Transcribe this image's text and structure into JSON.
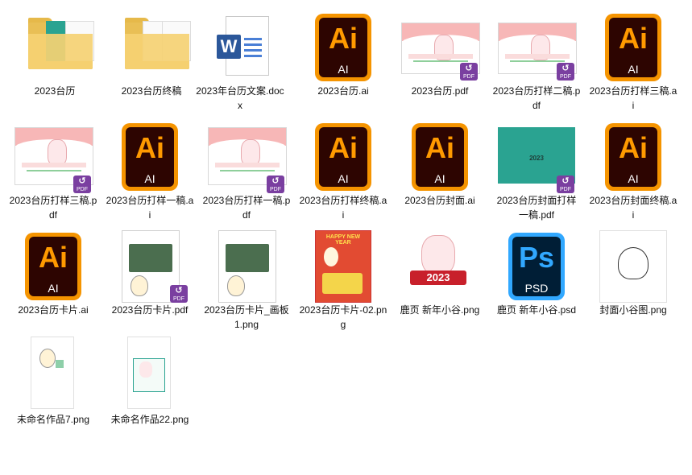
{
  "files": [
    {
      "name": "2023台历",
      "icon": "folder-icon",
      "type": "folder"
    },
    {
      "name": "2023台历终稿",
      "icon": "folder-icon",
      "type": "folder"
    },
    {
      "name": "2023年台历文案.docx",
      "icon": "word-doc-icon",
      "type": "docx"
    },
    {
      "name": "2023台历.ai",
      "icon": "illustrator-icon",
      "type": "ai"
    },
    {
      "name": "2023台历.pdf",
      "icon": "pdf-thumbnail-icon",
      "type": "pdf"
    },
    {
      "name": "2023台历打样二稿.pdf",
      "icon": "pdf-thumbnail-icon",
      "type": "pdf"
    },
    {
      "name": "2023台历打样三稿.ai",
      "icon": "illustrator-icon",
      "type": "ai"
    },
    {
      "name": "2023台历打样三稿.pdf",
      "icon": "pdf-thumbnail-icon",
      "type": "pdf"
    },
    {
      "name": "2023台历打样一稿.ai",
      "icon": "illustrator-icon",
      "type": "ai"
    },
    {
      "name": "2023台历打样一稿.pdf",
      "icon": "pdf-thumbnail-icon",
      "type": "pdf"
    },
    {
      "name": "2023台历打样终稿.ai",
      "icon": "illustrator-icon",
      "type": "ai"
    },
    {
      "name": "2023台历封面.ai",
      "icon": "illustrator-icon",
      "type": "ai"
    },
    {
      "name": "2023台历封面打样一稿.pdf",
      "icon": "pdf-thumbnail-icon",
      "type": "pdf"
    },
    {
      "name": "2023台历封面终稿.ai",
      "icon": "illustrator-icon",
      "type": "ai"
    },
    {
      "name": "2023台历卡片.ai",
      "icon": "illustrator-icon",
      "type": "ai"
    },
    {
      "name": "2023台历卡片.pdf",
      "icon": "pdf-thumbnail-icon",
      "type": "pdf"
    },
    {
      "name": "2023台历卡片_画板 1.png",
      "icon": "image-thumbnail-icon",
      "type": "png"
    },
    {
      "name": "2023台历卡片-02.png",
      "icon": "image-thumbnail-icon",
      "type": "png"
    },
    {
      "name": "鹿页 新年小谷.png",
      "icon": "image-thumbnail-icon",
      "type": "png"
    },
    {
      "name": "鹿页 新年小谷.psd",
      "icon": "photoshop-icon",
      "type": "psd"
    },
    {
      "name": "封面小谷图.png",
      "icon": "image-thumbnail-icon",
      "type": "png"
    },
    {
      "name": "未命名作品7.png",
      "icon": "image-thumbnail-icon",
      "type": "png"
    },
    {
      "name": "未命名作品22.png",
      "icon": "image-thumbnail-icon",
      "type": "png"
    }
  ],
  "icon_text": {
    "ai_big": "Ai",
    "ai_small": "AI",
    "ps_big": "Ps",
    "ps_small": "PSD",
    "word": "W",
    "pdf_badge": "PDF",
    "calendar_year": "2023",
    "happy_new_year": "HAPPY NEW YEAR"
  },
  "colors": {
    "ai_orange": "#f59400",
    "ai_dark": "#2d0501",
    "ps_blue": "#31a8ff",
    "ps_dark": "#001e36",
    "folder_yellow": "#e9bf55",
    "word_blue": "#2b579a",
    "pdf_purple": "#7a3fa0",
    "teal": "#2aa391"
  }
}
